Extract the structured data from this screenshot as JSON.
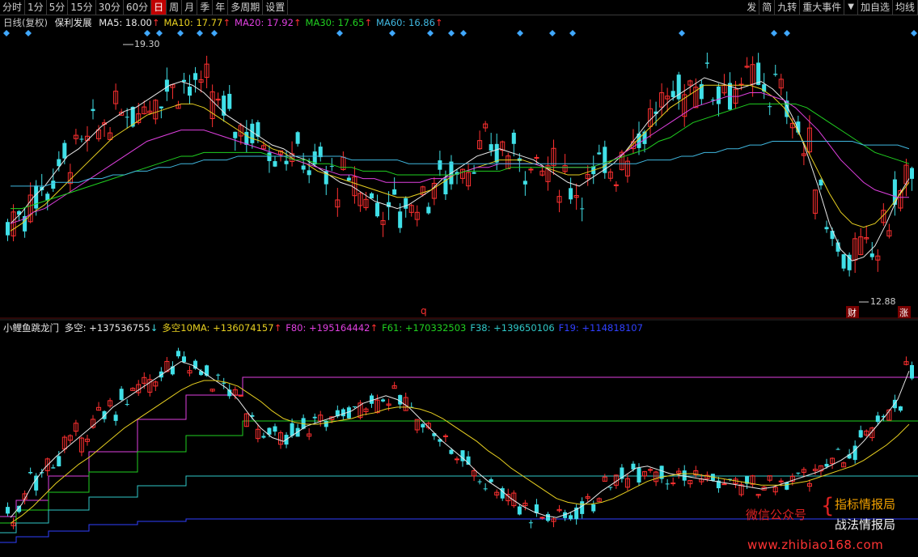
{
  "toolbar": {
    "periods": [
      "分时",
      "1分",
      "5分",
      "15分",
      "30分",
      "60分",
      "日",
      "周",
      "月",
      "季",
      "年",
      "多周期",
      "设置"
    ],
    "active": "日",
    "right": [
      "发",
      "简",
      "九转",
      "重大事件"
    ],
    "right2": [
      "加自选",
      "均线"
    ],
    "dropdown_icon": "caret-down-icon"
  },
  "main_legend": {
    "title": "日线(复权)",
    "stock": "保利发展",
    "items": [
      {
        "label": "MA5: 18.00",
        "arrow": "↑",
        "color": "#e8e8e8"
      },
      {
        "label": "MA10: 17.77",
        "arrow": "↑",
        "color": "#e8d020"
      },
      {
        "label": "MA20: 17.92",
        "arrow": "↑",
        "color": "#e040e0"
      },
      {
        "label": "MA30: 17.65",
        "arrow": "↑",
        "color": "#20d020"
      },
      {
        "label": "MA60: 16.86",
        "arrow": "↑",
        "color": "#40b8e0"
      }
    ]
  },
  "main_annotations": {
    "high_label": "19.30",
    "low_label": "12.88",
    "mark_q": "q",
    "badge_cai": "财",
    "badge_zhang": "涨"
  },
  "sub_legend": {
    "title": "小鲤鱼跳龙门",
    "items": [
      {
        "label": "多空: +137536755",
        "arrow": "↓",
        "color": "#e8e8e8"
      },
      {
        "label": "多空10MA: +136074157",
        "arrow": "↑",
        "color": "#e8d020"
      },
      {
        "label": "F80: +195164442",
        "arrow": "↑",
        "color": "#e040e0"
      },
      {
        "label": "F61: +170332503",
        "arrow": "",
        "color": "#20d020"
      },
      {
        "label": "F38: +139650106",
        "arrow": "",
        "color": "#30c8c8"
      },
      {
        "label": "F19: +114818107",
        "arrow": "",
        "color": "#3040ff"
      }
    ]
  },
  "watermark": {
    "wechat": "微信公众号",
    "line1": "指标情报局",
    "line2": "战法情报局",
    "url": "www.zhibiao168.com"
  },
  "colors": {
    "up": "#ff3030",
    "down": "#40e0e8",
    "bg": "#000000",
    "grid": "#5a1010"
  },
  "chart_data": [
    {
      "type": "candlestick",
      "title": "保利发展 日线(复权)",
      "ylim": [
        12.5,
        19.8
      ],
      "annotations": {
        "high": 19.3,
        "low": 12.88
      },
      "series": [
        {
          "name": "MA5",
          "values": [
            14.6,
            14.9,
            15.3,
            15.6,
            16.0,
            16.4,
            16.6,
            16.9,
            17.2,
            17.4,
            17.6,
            17.7,
            17.9,
            18.1,
            18.3,
            18.4,
            18.3,
            18.1,
            17.8,
            17.5,
            17.3,
            17.1,
            16.9,
            16.7,
            16.6,
            16.4,
            16.3,
            16.1,
            15.9,
            15.7,
            15.6,
            15.4,
            15.2,
            15.1,
            15.0,
            15.1,
            15.3,
            15.5,
            15.8,
            16.0,
            16.2,
            16.4,
            16.5,
            16.6,
            16.5,
            16.4,
            16.3,
            16.1,
            15.9,
            15.7,
            15.6,
            15.8,
            16.0,
            16.2,
            16.5,
            16.9,
            17.3,
            17.6,
            17.9,
            18.1,
            18.3,
            18.5,
            18.4,
            18.3,
            18.2,
            18.3,
            18.4,
            18.2,
            17.9,
            17.3,
            16.5,
            15.6,
            14.6,
            13.9,
            13.6,
            13.7,
            14.0,
            14.6,
            15.3,
            15.8
          ]
        },
        {
          "name": "MA10",
          "values": [
            14.4,
            14.6,
            14.9,
            15.1,
            15.4,
            15.7,
            16.0,
            16.3,
            16.6,
            16.9,
            17.1,
            17.3,
            17.5,
            17.6,
            17.7,
            17.8,
            17.8,
            17.7,
            17.5,
            17.3,
            17.1,
            16.9,
            16.8,
            16.6,
            16.5,
            16.3,
            16.2,
            16.0,
            15.9,
            15.8,
            15.7,
            15.6,
            15.5,
            15.4,
            15.3,
            15.3,
            15.4,
            15.5,
            15.7,
            15.9,
            16.0,
            16.1,
            16.2,
            16.3,
            16.3,
            16.3,
            16.2,
            16.1,
            16.0,
            15.9,
            15.9,
            16.0,
            16.1,
            16.3,
            16.5,
            16.8,
            17.1,
            17.4,
            17.7,
            17.9,
            18.1,
            18.3,
            18.3,
            18.3,
            18.3,
            18.3,
            18.2,
            18.0,
            17.7,
            17.2,
            16.6,
            16.0,
            15.4,
            14.9,
            14.6,
            14.5,
            14.6,
            14.9,
            15.3,
            15.7
          ]
        },
        {
          "name": "MA20",
          "values": [
            14.6,
            14.7,
            14.9,
            15.0,
            15.2,
            15.4,
            15.6,
            15.8,
            16.0,
            16.2,
            16.4,
            16.6,
            16.8,
            16.9,
            17.0,
            17.1,
            17.1,
            17.1,
            17.0,
            16.9,
            16.8,
            16.7,
            16.6,
            16.5,
            16.4,
            16.3,
            16.2,
            16.1,
            16.0,
            15.9,
            15.9,
            15.8,
            15.8,
            15.7,
            15.7,
            15.7,
            15.7,
            15.8,
            15.8,
            15.9,
            16.0,
            16.1,
            16.1,
            16.2,
            16.2,
            16.2,
            16.2,
            16.1,
            16.1,
            16.1,
            16.1,
            16.1,
            16.2,
            16.3,
            16.5,
            16.7,
            16.9,
            17.1,
            17.3,
            17.5,
            17.7,
            17.8,
            17.9,
            18.0,
            18.0,
            18.1,
            18.1,
            18.0,
            17.9,
            17.7,
            17.4,
            17.1,
            16.7,
            16.3,
            16.0,
            15.7,
            15.5,
            15.4,
            15.3,
            15.3
          ]
        },
        {
          "name": "MA30",
          "values": [
            15.0,
            15.0,
            15.1,
            15.2,
            15.3,
            15.4,
            15.5,
            15.6,
            15.7,
            15.8,
            15.9,
            16.0,
            16.1,
            16.2,
            16.3,
            16.4,
            16.4,
            16.5,
            16.5,
            16.5,
            16.5,
            16.5,
            16.5,
            16.4,
            16.4,
            16.3,
            16.3,
            16.2,
            16.2,
            16.1,
            16.1,
            16.0,
            16.0,
            16.0,
            15.9,
            15.9,
            15.9,
            15.9,
            15.9,
            15.9,
            16.0,
            16.0,
            16.0,
            16.0,
            16.1,
            16.1,
            16.1,
            16.1,
            16.1,
            16.1,
            16.1,
            16.1,
            16.2,
            16.3,
            16.4,
            16.5,
            16.6,
            16.8,
            16.9,
            17.1,
            17.3,
            17.4,
            17.5,
            17.6,
            17.7,
            17.8,
            17.8,
            17.8,
            17.8,
            17.8,
            17.7,
            17.5,
            17.3,
            17.1,
            16.9,
            16.7,
            16.5,
            16.4,
            16.3,
            16.2
          ]
        },
        {
          "name": "MA60",
          "values": [
            15.6,
            15.6,
            15.6,
            15.6,
            15.7,
            15.7,
            15.7,
            15.8,
            15.8,
            15.9,
            15.9,
            16.0,
            16.0,
            16.1,
            16.1,
            16.2,
            16.2,
            16.3,
            16.3,
            16.3,
            16.4,
            16.4,
            16.4,
            16.4,
            16.4,
            16.4,
            16.4,
            16.4,
            16.4,
            16.4,
            16.3,
            16.3,
            16.3,
            16.3,
            16.3,
            16.2,
            16.2,
            16.2,
            16.2,
            16.2,
            16.2,
            16.2,
            16.2,
            16.2,
            16.2,
            16.2,
            16.2,
            16.2,
            16.2,
            16.2,
            16.2,
            16.2,
            16.2,
            16.2,
            16.2,
            16.2,
            16.3,
            16.3,
            16.3,
            16.4,
            16.4,
            16.5,
            16.5,
            16.6,
            16.6,
            16.7,
            16.7,
            16.8,
            16.8,
            16.8,
            16.8,
            16.8,
            16.8,
            16.8,
            16.8,
            16.7,
            16.7,
            16.7,
            16.7,
            16.6
          ]
        }
      ]
    },
    {
      "type": "line",
      "title": "小鲤鱼跳龙门",
      "ylim": [
        0,
        1
      ],
      "series": [
        {
          "name": "多空",
          "values": [
            0.08,
            0.15,
            0.26,
            0.34,
            0.4,
            0.45,
            0.5,
            0.55,
            0.6,
            0.66,
            0.7,
            0.74,
            0.78,
            0.82,
            0.86,
            0.9,
            0.88,
            0.84,
            0.8,
            0.76,
            0.7,
            0.62,
            0.55,
            0.5,
            0.48,
            0.52,
            0.56,
            0.58,
            0.6,
            0.62,
            0.64,
            0.68,
            0.7,
            0.72,
            0.7,
            0.66,
            0.6,
            0.54,
            0.48,
            0.43,
            0.38,
            0.32,
            0.27,
            0.23,
            0.18,
            0.14,
            0.11,
            0.09,
            0.08,
            0.1,
            0.13,
            0.17,
            0.22,
            0.26,
            0.3,
            0.34,
            0.35,
            0.33,
            0.31,
            0.3,
            0.29,
            0.28,
            0.27,
            0.26,
            0.25,
            0.24,
            0.23,
            0.24,
            0.26,
            0.28,
            0.3,
            0.32,
            0.35,
            0.38,
            0.42,
            0.48,
            0.55,
            0.62,
            0.7,
            0.85
          ]
        },
        {
          "name": "多空10MA",
          "values": [
            0.05,
            0.09,
            0.14,
            0.2,
            0.26,
            0.31,
            0.36,
            0.4,
            0.45,
            0.5,
            0.55,
            0.59,
            0.63,
            0.67,
            0.71,
            0.75,
            0.78,
            0.8,
            0.8,
            0.79,
            0.77,
            0.73,
            0.69,
            0.64,
            0.6,
            0.58,
            0.57,
            0.57,
            0.58,
            0.59,
            0.6,
            0.62,
            0.63,
            0.65,
            0.66,
            0.66,
            0.65,
            0.63,
            0.6,
            0.56,
            0.52,
            0.48,
            0.43,
            0.39,
            0.34,
            0.3,
            0.26,
            0.22,
            0.18,
            0.16,
            0.15,
            0.15,
            0.16,
            0.18,
            0.21,
            0.24,
            0.27,
            0.29,
            0.3,
            0.31,
            0.31,
            0.3,
            0.29,
            0.28,
            0.27,
            0.26,
            0.25,
            0.25,
            0.25,
            0.26,
            0.27,
            0.29,
            0.31,
            0.33,
            0.35,
            0.38,
            0.42,
            0.46,
            0.51,
            0.57
          ]
        }
      ]
    }
  ]
}
